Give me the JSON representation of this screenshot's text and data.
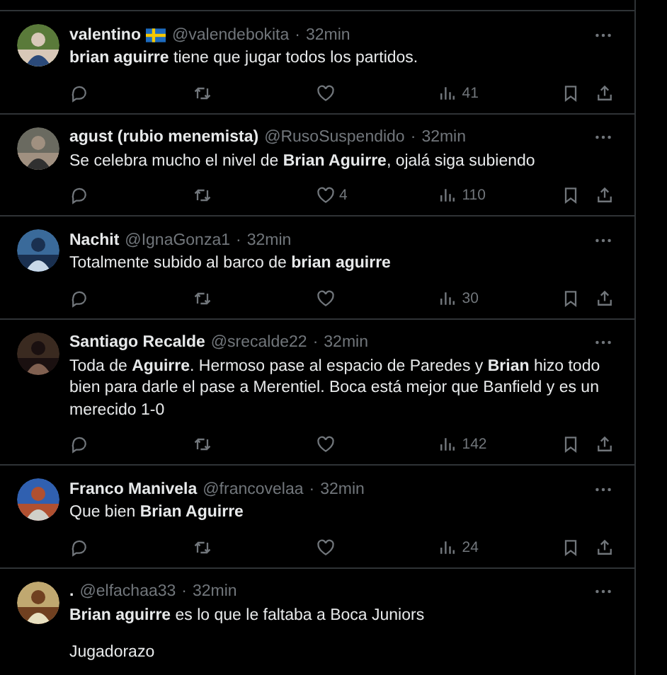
{
  "tweets": [
    {
      "name": "valentino",
      "flag": true,
      "handle": "@valendebokita",
      "sep": "·",
      "time": "32min",
      "text": [
        "**brian aguirre** tiene que jugar todos los partidos."
      ],
      "views": "41"
    },
    {
      "name": "agust (rubio menemista)",
      "handle": "@RusoSuspendido",
      "sep": "·",
      "time": "32min",
      "text": [
        "Se celebra mucho el nivel de **Brian Aguirre**, ojalá siga subiendo"
      ],
      "likes": "4",
      "views": "110"
    },
    {
      "name": "Nachit",
      "handle": "@IgnaGonza1",
      "sep": "·",
      "time": "32min",
      "text": [
        "Totalmente subido al barco de **brian aguirre**"
      ],
      "views": "30"
    },
    {
      "name": "Santiago Recalde",
      "handle": "@srecalde22",
      "sep": "·",
      "time": "32min",
      "text": [
        "Toda de **Aguirre**. Hermoso pase al espacio de Paredes y **Brian** hizo todo bien para darle el pase a Merentiel. Boca está mejor que Banfield y es un merecido 1-0"
      ],
      "views": "142"
    },
    {
      "name": "Franco Manivela",
      "handle": "@francovelaa",
      "sep": "·",
      "time": "32min",
      "text": [
        "Que bien **Brian Aguirre**"
      ],
      "views": "24"
    },
    {
      "name": ".",
      "handle": "@elfachaa33",
      "sep": "·",
      "time": "32min",
      "text": [
        "**Brian aguirre** es lo que le faltaba a Boca Juniors",
        "Jugadorazo"
      ]
    }
  ]
}
